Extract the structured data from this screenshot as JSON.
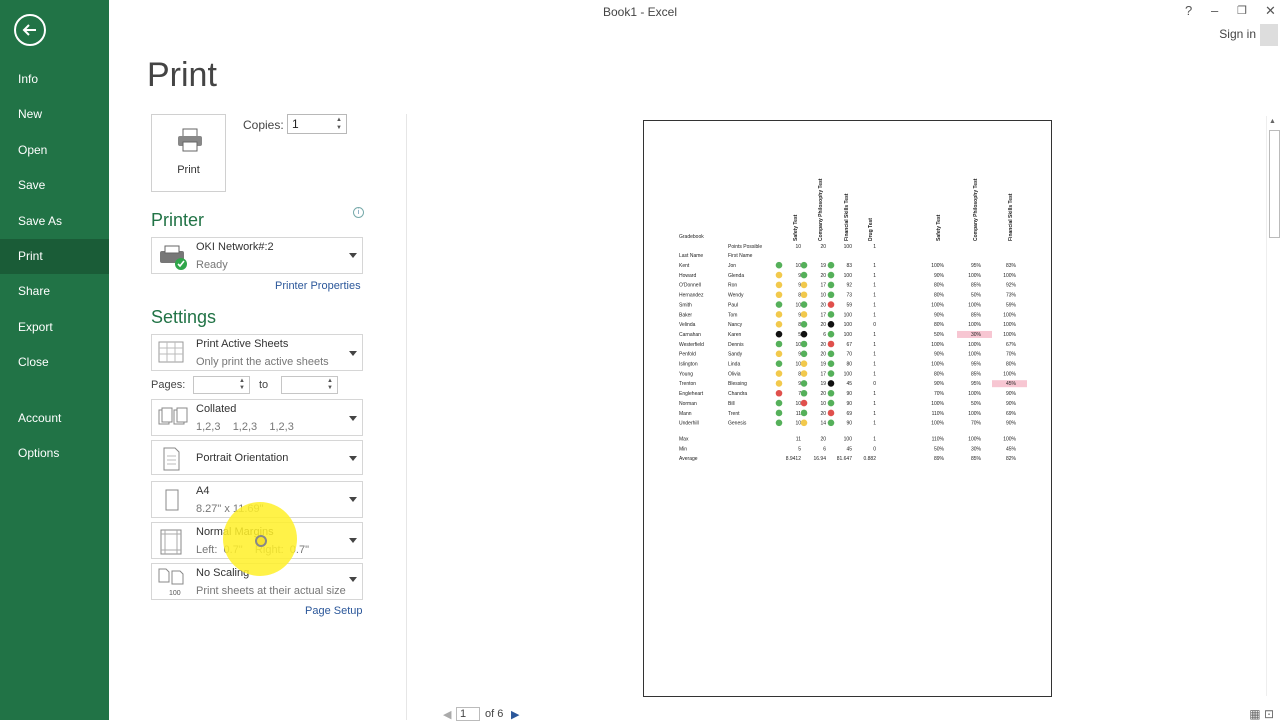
{
  "window": {
    "title": "Book1 - Excel",
    "help": "?",
    "minimize": "–",
    "restore": "❐",
    "close": "✕",
    "sign_in": "Sign in"
  },
  "nav": {
    "items": [
      {
        "label": "Info",
        "active": false
      },
      {
        "label": "New",
        "active": false
      },
      {
        "label": "Open",
        "active": false
      },
      {
        "label": "Save",
        "active": false
      },
      {
        "label": "Save As",
        "active": false
      },
      {
        "label": "Print",
        "active": true
      },
      {
        "label": "Share",
        "active": false
      },
      {
        "label": "Export",
        "active": false
      },
      {
        "label": "Close",
        "active": false
      },
      {
        "label": "Account",
        "active": false
      },
      {
        "label": "Options",
        "active": false
      }
    ]
  },
  "print": {
    "heading": "Print",
    "button_label": "Print",
    "copies_label": "Copies:",
    "copies_value": "1"
  },
  "printer": {
    "heading": "Printer",
    "name": "OKI Network#:2",
    "status": "Ready",
    "properties_link": "Printer Properties"
  },
  "settings": {
    "heading": "Settings",
    "what": {
      "title": "Print Active Sheets",
      "sub": "Only print the active sheets"
    },
    "pages_label": "Pages:",
    "to_label": "to",
    "collate": {
      "title": "Collated",
      "sub": "1,2,3    1,2,3    1,2,3"
    },
    "orientation": {
      "title": "Portrait Orientation"
    },
    "paper": {
      "title": "A4",
      "sub": "8.27\" x 11.69\""
    },
    "margins": {
      "title": "Normal Margins",
      "sub": "Left:  0.7\"    Right:  0.7\""
    },
    "scaling": {
      "title": "No Scaling",
      "sub": "Print sheets at their actual size"
    },
    "page_setup_link": "Page Setup"
  },
  "preview": {
    "current_page": "1",
    "of_pages": "of 6",
    "sheet": {
      "title": "Gradebook",
      "points_label": "Points Possible",
      "last_name_header": "Last Name",
      "first_name_header": "First Name",
      "test_headers": [
        "Safety Test",
        "Company Philosophy Test",
        "Financial Skills Test",
        "Drug Test"
      ],
      "pct_headers": [
        "Safety Test",
        "Company Philosophy Test",
        "Financial Skills Test"
      ],
      "points": [
        "10",
        "20",
        "100",
        "1"
      ],
      "rows": [
        {
          "last": "Kent",
          "first": "Jon",
          "s": [
            "10",
            "19",
            "83",
            "1"
          ],
          "d": [
            "g",
            "g",
            "g"
          ],
          "p": [
            "100%",
            "95%",
            "83%"
          ]
        },
        {
          "last": "Howard",
          "first": "Glenda",
          "s": [
            "9",
            "20",
            "100",
            "1"
          ],
          "d": [
            "y",
            "g",
            "g"
          ],
          "p": [
            "90%",
            "100%",
            "100%"
          ]
        },
        {
          "last": "O'Donnell",
          "first": "Ron",
          "s": [
            "9",
            "17",
            "92",
            "1"
          ],
          "d": [
            "y",
            "y",
            "g"
          ],
          "p": [
            "80%",
            "85%",
            "92%"
          ]
        },
        {
          "last": "Hernandez",
          "first": "Wendy",
          "s": [
            "8",
            "10",
            "73",
            "1"
          ],
          "d": [
            "y",
            "y",
            "g"
          ],
          "p": [
            "80%",
            "50%",
            "73%"
          ]
        },
        {
          "last": "Smith",
          "first": "Paul",
          "s": [
            "10",
            "20",
            "59",
            "1"
          ],
          "d": [
            "g",
            "g",
            "r"
          ],
          "p": [
            "100%",
            "100%",
            "59%"
          ]
        },
        {
          "last": "Baker",
          "first": "Tom",
          "s": [
            "9",
            "17",
            "100",
            "1"
          ],
          "d": [
            "y",
            "y",
            "g"
          ],
          "p": [
            "90%",
            "85%",
            "100%"
          ]
        },
        {
          "last": "Velinda",
          "first": "Nancy",
          "s": [
            "8",
            "20",
            "100",
            "0"
          ],
          "d": [
            "y",
            "g",
            "k"
          ],
          "p": [
            "80%",
            "100%",
            "100%"
          ]
        },
        {
          "last": "Carnahan",
          "first": "Karen",
          "s": [
            "5",
            "6",
            "100",
            "1"
          ],
          "d": [
            "k",
            "k",
            "g"
          ],
          "p": [
            "50%",
            "30%",
            "100%"
          ]
        },
        {
          "last": "Westerfield",
          "first": "Dennis",
          "s": [
            "10",
            "20",
            "67",
            "1"
          ],
          "d": [
            "g",
            "g",
            "r"
          ],
          "p": [
            "100%",
            "100%",
            "67%"
          ]
        },
        {
          "last": "Penfold",
          "first": "Sandy",
          "s": [
            "9",
            "20",
            "70",
            "1"
          ],
          "d": [
            "y",
            "g",
            "g"
          ],
          "p": [
            "90%",
            "100%",
            "70%"
          ]
        },
        {
          "last": "Islington",
          "first": "Linda",
          "s": [
            "10",
            "19",
            "80",
            "1"
          ],
          "d": [
            "g",
            "y",
            "g"
          ],
          "p": [
            "100%",
            "95%",
            "80%"
          ]
        },
        {
          "last": "Young",
          "first": "Olivia",
          "s": [
            "8",
            "17",
            "100",
            "1"
          ],
          "d": [
            "y",
            "y",
            "g"
          ],
          "p": [
            "80%",
            "85%",
            "100%"
          ]
        },
        {
          "last": "Trenton",
          "first": "Blessing",
          "s": [
            "9",
            "19",
            "45",
            "0"
          ],
          "d": [
            "y",
            "g",
            "k"
          ],
          "p": [
            "90%",
            "95%",
            "45%"
          ]
        },
        {
          "last": "Engleheart",
          "first": "Chandra",
          "s": [
            "7",
            "20",
            "90",
            "1"
          ],
          "d": [
            "r",
            "g",
            "g"
          ],
          "p": [
            "70%",
            "100%",
            "90%"
          ]
        },
        {
          "last": "Norman",
          "first": "Bill",
          "s": [
            "10",
            "10",
            "90",
            "1"
          ],
          "d": [
            "g",
            "r",
            "g"
          ],
          "p": [
            "100%",
            "50%",
            "90%"
          ]
        },
        {
          "last": "Mann",
          "first": "Trent",
          "s": [
            "11",
            "20",
            "69",
            "1"
          ],
          "d": [
            "g",
            "g",
            "r"
          ],
          "p": [
            "110%",
            "100%",
            "69%"
          ]
        },
        {
          "last": "Underhill",
          "first": "Genesis",
          "s": [
            "10",
            "14",
            "90",
            "1"
          ],
          "d": [
            "g",
            "y",
            "g"
          ],
          "p": [
            "100%",
            "70%",
            "90%"
          ]
        }
      ],
      "stats": [
        {
          "label": "Max",
          "s": [
            "11",
            "20",
            "100",
            "1"
          ],
          "p": [
            "110%",
            "100%",
            "100%"
          ]
        },
        {
          "label": "Min",
          "s": [
            "5",
            "6",
            "45",
            "0"
          ],
          "p": [
            "50%",
            "30%",
            "45%"
          ]
        },
        {
          "label": "Average",
          "s": [
            "8.9412",
            "16.94",
            "81.647",
            "0.882"
          ],
          "p": [
            "89%",
            "85%",
            "82%"
          ]
        }
      ]
    }
  },
  "colors": {
    "accent": "#217346",
    "accent_dark": "#1a5c37",
    "dot_green": "#55b05a",
    "dot_yellow": "#f2c94c",
    "dot_red": "#e0504c",
    "dot_black": "#111111",
    "highlight_pink": "#f7c6d2"
  }
}
